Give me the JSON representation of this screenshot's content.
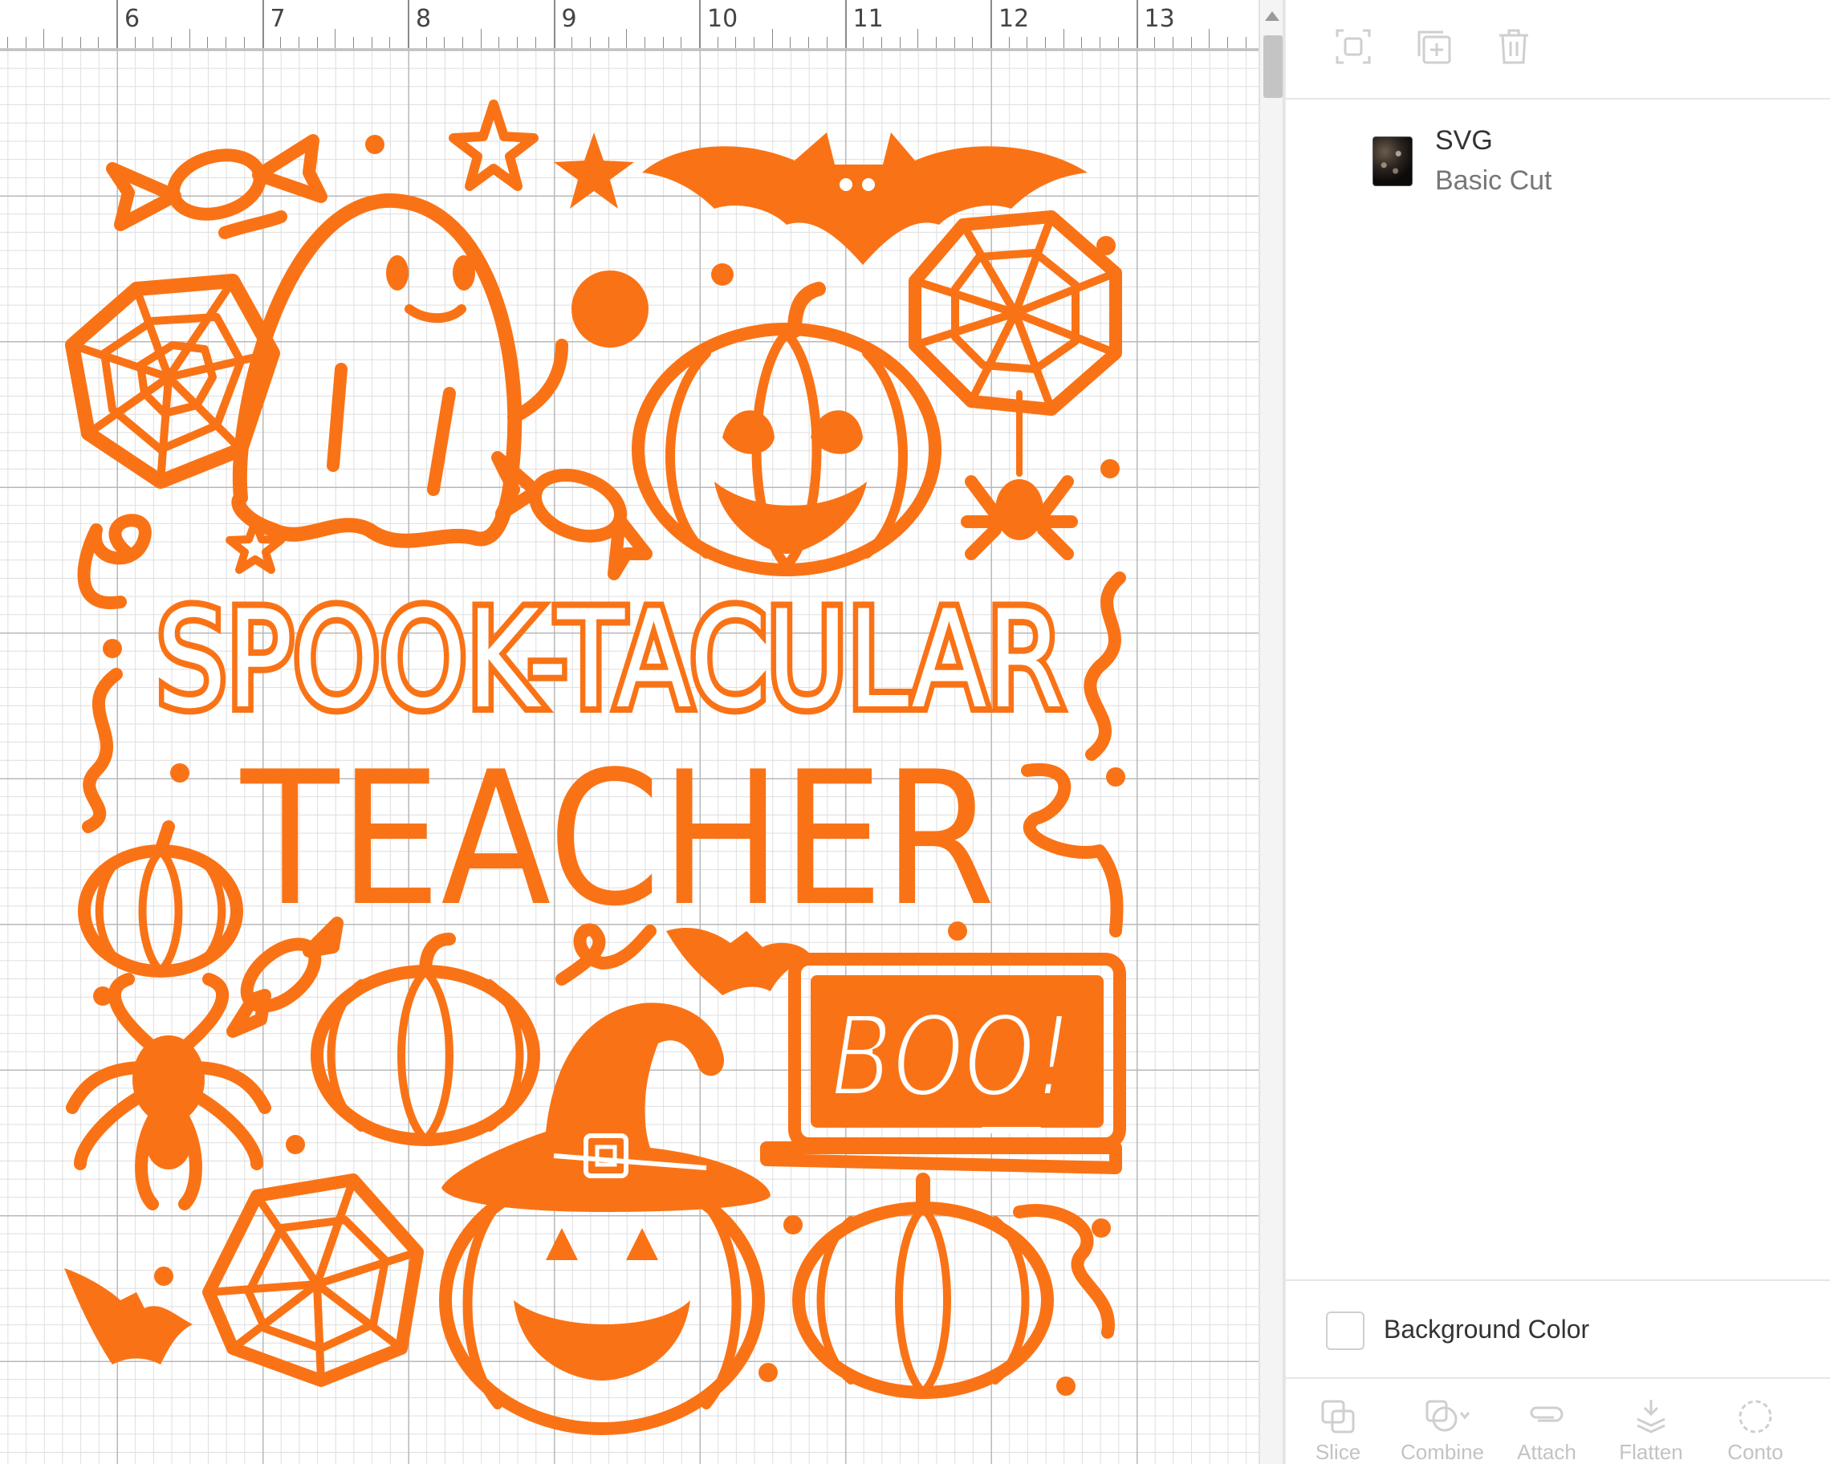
{
  "ruler": {
    "labels": [
      "6",
      "7",
      "8",
      "9",
      "10",
      "11",
      "12",
      "13"
    ]
  },
  "design": {
    "line1": "SPOOK-TACULAR",
    "line2": "TEACHER",
    "board_text": "BOO!",
    "color": "#F97316"
  },
  "toolbar": {
    "icons": [
      "group-icon",
      "duplicate-icon",
      "delete-icon"
    ]
  },
  "layers": [
    {
      "name": "SVG",
      "type": "Basic Cut",
      "thumbnail": "layer-thumbnail"
    }
  ],
  "background": {
    "label": "Background Color",
    "swatch": "#FFFFFF"
  },
  "bottom_tools": [
    {
      "label": "Slice",
      "icon": "slice-icon"
    },
    {
      "label": "Combine",
      "icon": "combine-icon"
    },
    {
      "label": "Attach",
      "icon": "attach-icon"
    },
    {
      "label": "Flatten",
      "icon": "flatten-icon"
    },
    {
      "label": "Conto",
      "icon": "contour-icon"
    }
  ],
  "colors": {
    "accent": "#F97316",
    "grid_major": "#B8B8B8",
    "grid_minor": "#DEDEDE",
    "disabled": "#C3C3C3"
  }
}
